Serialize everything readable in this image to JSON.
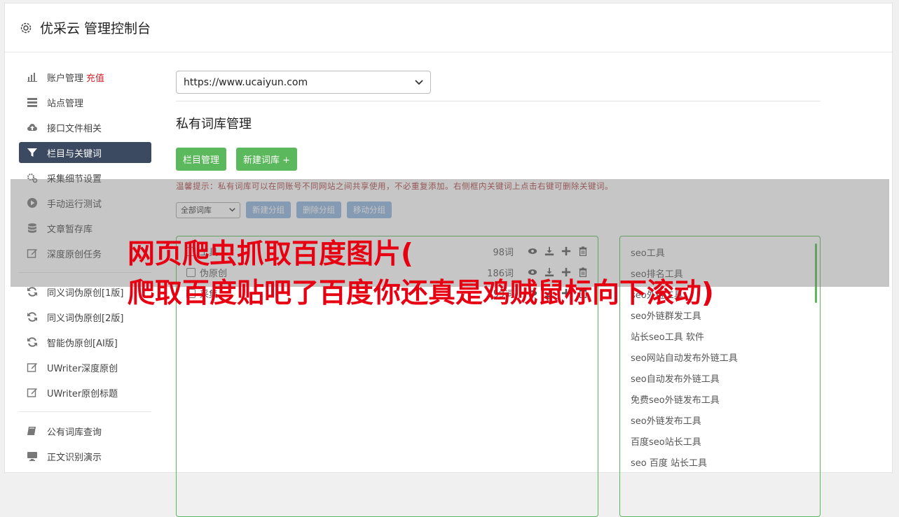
{
  "header": {
    "title": "优采云 管理控制台",
    "icon": "gear-icon"
  },
  "sidebar": {
    "groups": [
      [
        {
          "label": "账户管理",
          "icon": "bar-chart-icon",
          "extra": "充值"
        },
        {
          "label": "站点管理",
          "icon": "server-icon"
        },
        {
          "label": "接口文件相关",
          "icon": "cloud-upload-icon"
        },
        {
          "label": "栏目与关键词",
          "icon": "filter-icon",
          "active": true
        },
        {
          "label": "采集细节设置",
          "icon": "gears-icon"
        },
        {
          "label": "手动运行测试",
          "icon": "play-icon"
        },
        {
          "label": "文章暂存库",
          "icon": "database-icon"
        },
        {
          "label": "深度原创任务",
          "icon": "edit-icon"
        }
      ],
      [
        {
          "label": "同义词伪原创[1版]",
          "icon": "refresh-icon"
        },
        {
          "label": "同义词伪原创[2版]",
          "icon": "refresh-icon"
        },
        {
          "label": "智能伪原创[AI版]",
          "icon": "refresh-icon"
        },
        {
          "label": "UWriter深度原创",
          "icon": "edit-icon"
        },
        {
          "label": "UWriter原创标题",
          "icon": "edit-icon"
        }
      ],
      [
        {
          "label": "公有词库查询",
          "icon": "book-icon"
        },
        {
          "label": "正文识别演示",
          "icon": "monitor-icon"
        }
      ]
    ]
  },
  "main": {
    "site_select": "https://www.ucaiyun.com",
    "section_title": "私有词库管理",
    "buttons": {
      "column_manage": "栏目管理",
      "new_library": "新建词库 +"
    },
    "tip": "温馨提示：私有词库可以在同账号不同网站之间共享使用，不必重复添加。右侧框内关键词上点击右键可删除关键词。",
    "library_filter": "全部词库",
    "group_buttons": {
      "new": "新建分组",
      "delete": "删除分组",
      "move": "移动分组"
    },
    "groups": [
      {
        "name": "工具",
        "count": "98词"
      },
      {
        "name": "伪原创",
        "count": "186词"
      },
      {
        "name": "采集",
        "count": "259词"
      }
    ],
    "keywords": [
      "seo工具",
      "seo排名工具",
      "seo外链工具",
      "seo外链群发工具",
      "站长seo工具 软件",
      "seo网站自动发布外链工具",
      "seo自动发布外链工具",
      "免费seo外链发布工具",
      "seo外链发布工具",
      "百度seo站长工具",
      "seo 百度 站长工具"
    ]
  },
  "overlay": {
    "line1": "网页爬虫抓取百度图片(",
    "line2": "爬取百度贴吧了百度你还真是鸡贼鼠标向下滚动)"
  },
  "colors": {
    "green": "#5cb85c",
    "active_nav": "#3b4a60",
    "overlay_text": "#e60012",
    "blue_btn": "#8fb3de"
  }
}
